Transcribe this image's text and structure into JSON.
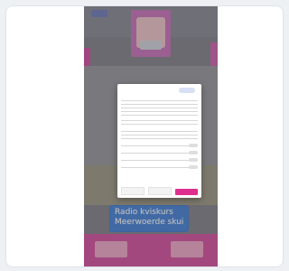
{
  "promo": {
    "line1": "Radio kviskurs",
    "line2": "Meerwoerde skuif"
  },
  "colors": {
    "brand_pink": "#df2f8e",
    "banner_blue": "#3f7ed8"
  }
}
